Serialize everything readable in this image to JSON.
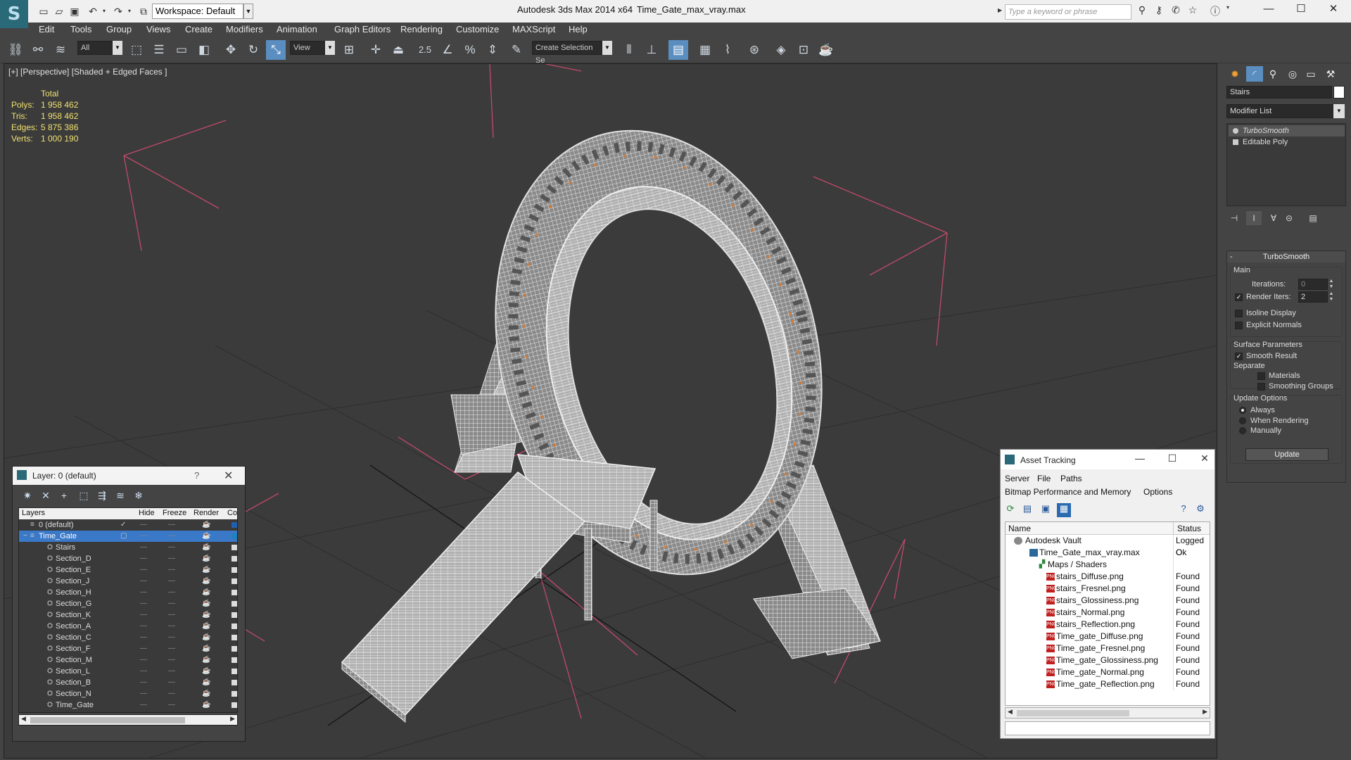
{
  "window": {
    "app_title": "Autodesk 3ds Max  2014 x64",
    "file_title": "Time_Gate_max_vray.max",
    "workspace": "Workspace: Default",
    "search_placeholder": "Type a keyword or phrase",
    "minimize": "—",
    "maximize": "☐",
    "close": "✕"
  },
  "menu": [
    "Edit",
    "Tools",
    "Group",
    "Views",
    "Create",
    "Modifiers",
    "Animation",
    "Graph Editors",
    "Rendering",
    "Customize",
    "MAXScript",
    "Help"
  ],
  "toolbar": {
    "selection_filter": "All",
    "reference_coord": "View",
    "named_selection": "Create Selection Se",
    "snap_label": "2.5"
  },
  "viewport": {
    "label": "[+] [Perspective] [Shaded + Edged Faces ]",
    "stats_header": "Total",
    "stats": [
      {
        "label": "Polys:",
        "value": "1 958 462"
      },
      {
        "label": "Tris:",
        "value": "1 958 462"
      },
      {
        "label": "Edges:",
        "value": "5 875 386"
      },
      {
        "label": "Verts:",
        "value": "1 000 190"
      }
    ]
  },
  "command_panel": {
    "object_name": "Stairs",
    "modifier_list": "Modifier List",
    "stack": [
      "TurboSmooth",
      "Editable Poly"
    ],
    "rollout_title": "TurboSmooth",
    "main_group": "Main",
    "iterations_label": "Iterations:",
    "iterations_value": "0",
    "render_iters_label": "Render Iters:",
    "render_iters_value": "2",
    "isoline_label": "Isoline Display",
    "explicit_normals_label": "Explicit Normals",
    "surface_params": "Surface Parameters",
    "smooth_result": "Smooth Result",
    "separate": "Separate",
    "materials": "Materials",
    "smoothing_groups": "Smoothing Groups",
    "update_options": "Update Options",
    "always": "Always",
    "when_rendering": "When Rendering",
    "manually": "Manually",
    "update_button": "Update"
  },
  "layer_panel": {
    "title": "Layer: 0 (default)",
    "help": "?",
    "columns": [
      "Layers",
      "Hide",
      "Freeze",
      "Render",
      "Col"
    ],
    "layers": [
      {
        "name": "0 (default)",
        "level": 0,
        "selected": false,
        "color": "#2060b0"
      },
      {
        "name": "Time_Gate",
        "level": 0,
        "selected": true,
        "color": "#2080c0"
      },
      {
        "name": "Stairs",
        "level": 1,
        "selected": false,
        "color": ""
      },
      {
        "name": "Section_D",
        "level": 1,
        "selected": false,
        "color": ""
      },
      {
        "name": "Section_E",
        "level": 1,
        "selected": false,
        "color": ""
      },
      {
        "name": "Section_J",
        "level": 1,
        "selected": false,
        "color": ""
      },
      {
        "name": "Section_H",
        "level": 1,
        "selected": false,
        "color": ""
      },
      {
        "name": "Section_G",
        "level": 1,
        "selected": false,
        "color": ""
      },
      {
        "name": "Section_K",
        "level": 1,
        "selected": false,
        "color": ""
      },
      {
        "name": "Section_A",
        "level": 1,
        "selected": false,
        "color": ""
      },
      {
        "name": "Section_C",
        "level": 1,
        "selected": false,
        "color": ""
      },
      {
        "name": "Section_F",
        "level": 1,
        "selected": false,
        "color": ""
      },
      {
        "name": "Section_M",
        "level": 1,
        "selected": false,
        "color": ""
      },
      {
        "name": "Section_L",
        "level": 1,
        "selected": false,
        "color": ""
      },
      {
        "name": "Section_B",
        "level": 1,
        "selected": false,
        "color": ""
      },
      {
        "name": "Section_N",
        "level": 1,
        "selected": false,
        "color": ""
      },
      {
        "name": "Time_Gate",
        "level": 1,
        "selected": false,
        "color": ""
      }
    ]
  },
  "asset_tracking": {
    "title": "Asset Tracking",
    "menu1": [
      "Server",
      "File",
      "Paths"
    ],
    "menu2": [
      "Bitmap Performance and Memory",
      "Options"
    ],
    "columns": [
      "Name",
      "Status"
    ],
    "rows": [
      {
        "name": "Autodesk Vault",
        "status": "Logged O",
        "level": 0,
        "type": "vault"
      },
      {
        "name": "Time_Gate_max_vray.max",
        "status": "Ok",
        "level": 1,
        "type": "max"
      },
      {
        "name": "Maps / Shaders",
        "status": "",
        "level": 2,
        "type": "folder"
      },
      {
        "name": "stairs_Diffuse.png",
        "status": "Found",
        "level": 3,
        "type": "png"
      },
      {
        "name": "stairs_Fresnel.png",
        "status": "Found",
        "level": 3,
        "type": "png"
      },
      {
        "name": "stairs_Glossiness.png",
        "status": "Found",
        "level": 3,
        "type": "png"
      },
      {
        "name": "stairs_Normal.png",
        "status": "Found",
        "level": 3,
        "type": "png"
      },
      {
        "name": "stairs_Reflection.png",
        "status": "Found",
        "level": 3,
        "type": "png"
      },
      {
        "name": "Time_gate_Diffuse.png",
        "status": "Found",
        "level": 3,
        "type": "png"
      },
      {
        "name": "Time_gate_Fresnel.png",
        "status": "Found",
        "level": 3,
        "type": "png"
      },
      {
        "name": "Time_gate_Glossiness.png",
        "status": "Found",
        "level": 3,
        "type": "png"
      },
      {
        "name": "Time_gate_Normal.png",
        "status": "Found",
        "level": 3,
        "type": "png"
      },
      {
        "name": "Time_gate_Reflection.png",
        "status": "Found",
        "level": 3,
        "type": "png"
      }
    ]
  }
}
